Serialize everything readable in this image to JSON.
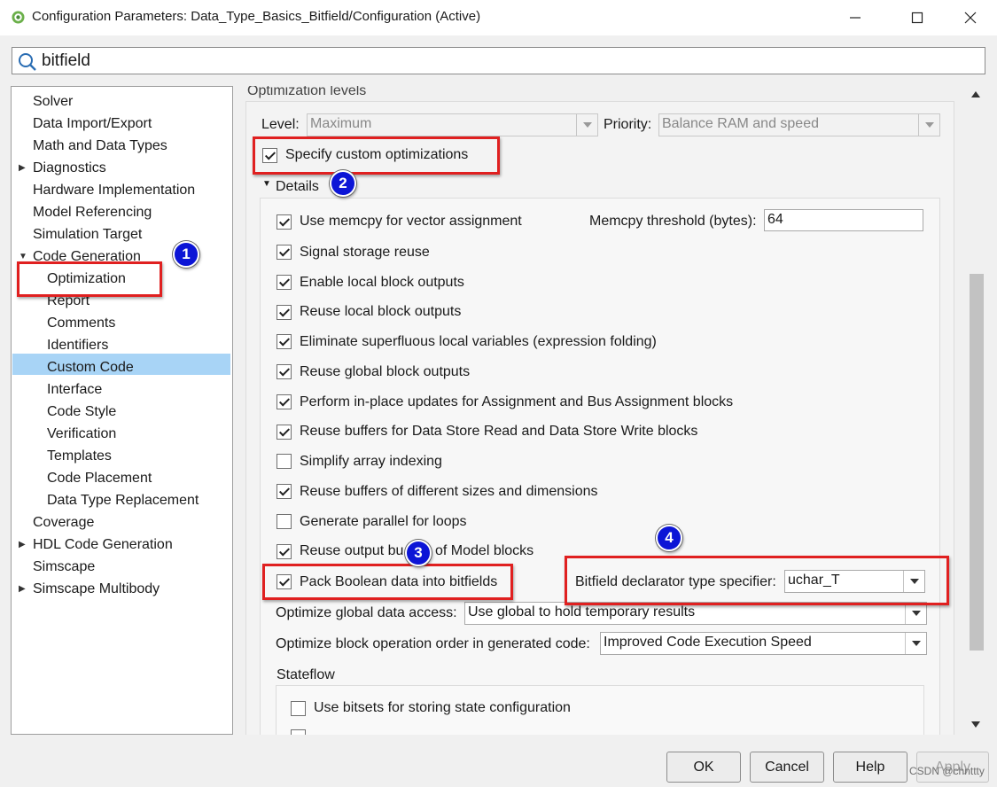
{
  "window": {
    "title": "Configuration Parameters: Data_Type_Basics_Bitfield/Configuration (Active)",
    "icon": "gear-icon"
  },
  "search": {
    "value": "bitfield"
  },
  "tree": {
    "items": [
      {
        "label": "Solver"
      },
      {
        "label": "Data Import/Export"
      },
      {
        "label": "Math and Data Types"
      },
      {
        "label": "Diagnostics"
      },
      {
        "label": "Hardware Implementation"
      },
      {
        "label": "Model Referencing"
      },
      {
        "label": "Simulation Target"
      },
      {
        "label": "Code Generation"
      },
      {
        "label": "Optimization"
      },
      {
        "label": "Report"
      },
      {
        "label": "Comments"
      },
      {
        "label": "Identifiers"
      },
      {
        "label": "Custom Code"
      },
      {
        "label": "Interface"
      },
      {
        "label": "Code Style"
      },
      {
        "label": "Verification"
      },
      {
        "label": "Templates"
      },
      {
        "label": "Code Placement"
      },
      {
        "label": "Data Type Replacement"
      },
      {
        "label": "Coverage"
      },
      {
        "label": "HDL Code Generation"
      },
      {
        "label": "Simscape"
      },
      {
        "label": "Simscape Multibody"
      }
    ],
    "selected": "Optimization"
  },
  "optimization": {
    "section_label": "Optimization levels",
    "level_label": "Level:",
    "level_value": "Maximum",
    "priority_label": "Priority:",
    "priority_value": "Balance RAM and speed",
    "custom_label": "Specify custom optimizations",
    "details_label": "Details",
    "memcpy_threshold_label": "Memcpy threshold (bytes):",
    "memcpy_threshold_value": "64",
    "options": [
      {
        "label": "Use memcpy for vector assignment",
        "checked": true
      },
      {
        "label": "Signal storage reuse",
        "checked": true
      },
      {
        "label": "Enable local block outputs",
        "checked": true
      },
      {
        "label": "Reuse local block outputs",
        "checked": true
      },
      {
        "label": "Eliminate superfluous local variables (expression folding)",
        "checked": true
      },
      {
        "label": "Reuse global block outputs",
        "checked": true
      },
      {
        "label": "Perform in-place updates for Assignment and Bus Assignment blocks",
        "checked": true
      },
      {
        "label": "Reuse buffers for Data Store Read and Data Store Write blocks",
        "checked": true
      },
      {
        "label": "Simplify array indexing",
        "checked": false
      },
      {
        "label": "Reuse buffers of different sizes and dimensions",
        "checked": true
      },
      {
        "label": "Generate parallel for loops",
        "checked": false
      },
      {
        "label": "Reuse output bu",
        "label_tail": "of Model blocks",
        "checked": true
      },
      {
        "label": "Pack Boolean data into bitfields",
        "checked": true
      }
    ],
    "bitfield_label": "Bitfield declarator type specifier:",
    "bitfield_value": "uchar_T",
    "global_access_label": "Optimize global data access:",
    "global_access_value": "Use global to hold temporary results",
    "block_order_label": "Optimize block operation order in generated code:",
    "block_order_value": "Improved Code Execution Speed",
    "stateflow_label": "Stateflow",
    "stateflow_bitsets_label": "Use bitsets for storing state configuration"
  },
  "annotations": {
    "markers": [
      "1",
      "2",
      "3",
      "4"
    ],
    "color": "#e02020",
    "marker_color": "#0c15d6"
  },
  "buttons": {
    "ok": "OK",
    "cancel": "Cancel",
    "help": "Help",
    "apply": "Apply"
  },
  "watermark": "CSDN @chnttty"
}
